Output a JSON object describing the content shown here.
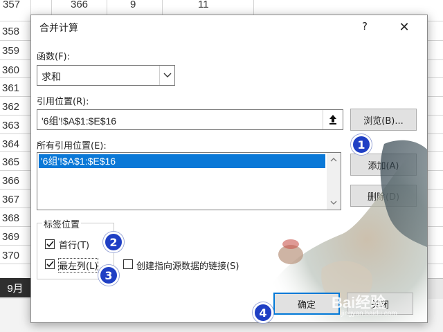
{
  "sheet": {
    "row_headers": [
      "357",
      "358",
      "359",
      "360",
      "361",
      "362",
      "363",
      "364",
      "365",
      "366",
      "367",
      "368",
      "369",
      "370"
    ],
    "top_cells": [
      "357",
      "366",
      "9",
      "11"
    ],
    "sheet_tab": "9月"
  },
  "dialog": {
    "title": "合并计算",
    "help": "?",
    "close": "✕",
    "function_label": "函数(F):",
    "function_value": "求和",
    "reference_label": "引用位置(R):",
    "reference_value": "'6组'!$A$1:$E$16",
    "browse_button": "浏览(B)...",
    "all_refs_label": "所有引用位置(E):",
    "all_refs": [
      "'6组'!$A$1:$E$16"
    ],
    "add_button": "添加(A)",
    "delete_button": "删除(D)",
    "labels_group": "标签位置",
    "top_row_label": "首行(T)",
    "top_row_checked": true,
    "left_col_label": "最左列(L)",
    "left_col_checked": true,
    "link_label": "创建指向源数据的链接(S)",
    "link_checked": false,
    "ok_button": "确定",
    "cancel_button": "关闭"
  },
  "badges": [
    "1",
    "2",
    "3",
    "4"
  ],
  "watermark": {
    "brand": "Bai经验",
    "url": "jingyan.baidu.com"
  },
  "colors": {
    "selection": "#0a78d7",
    "badge": "#1f3fc4",
    "focus": "#0078d7"
  }
}
